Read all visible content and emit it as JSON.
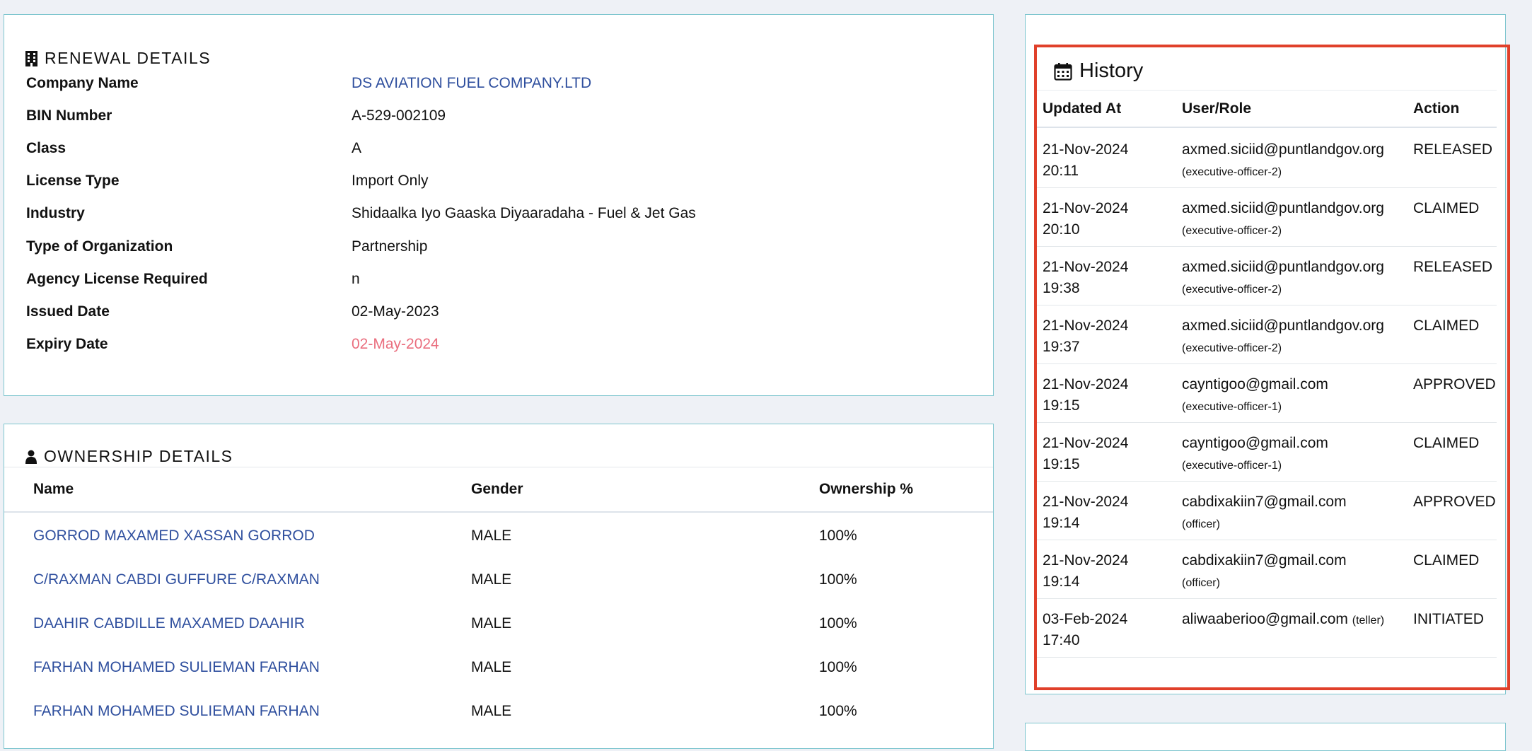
{
  "renewal": {
    "title": "RENEWAL DETAILS",
    "rows": [
      {
        "label": "Company Name",
        "value": "DS AVIATION FUEL COMPANY.LTD"
      },
      {
        "label": "BIN Number",
        "value": "A-529-002109"
      },
      {
        "label": "Class",
        "value": "A"
      },
      {
        "label": "License Type",
        "value": "Import Only"
      },
      {
        "label": "Industry",
        "value": "Shidaalka Iyo Gaaska Diyaaradaha - Fuel & Jet Gas"
      },
      {
        "label": "Type of Organization",
        "value": "Partnership"
      },
      {
        "label": "Agency License Required",
        "value": "n"
      },
      {
        "label": "Issued Date",
        "value": "02-May-2023"
      },
      {
        "label": "Expiry Date",
        "value": "02-May-2024"
      }
    ]
  },
  "ownership": {
    "title": "OWNERSHIP DETAILS",
    "columns": {
      "name": "Name",
      "gender": "Gender",
      "ownership": "Ownership %"
    },
    "rows": [
      {
        "name": "GORROD MAXAMED XASSAN GORROD",
        "gender": "MALE",
        "ownership": "100%"
      },
      {
        "name": "C/RAXMAN CABDI GUFFURE C/RAXMAN",
        "gender": "MALE",
        "ownership": "100%"
      },
      {
        "name": "DAAHIR CABDILLE MAXAMED DAAHIR",
        "gender": "MALE",
        "ownership": "100%"
      },
      {
        "name": "FARHAN MOHAMED SULIEMAN FARHAN",
        "gender": "MALE",
        "ownership": "100%"
      },
      {
        "name": "FARHAN MOHAMED SULIEMAN FARHAN",
        "gender": "MALE",
        "ownership": "100%"
      }
    ]
  },
  "history": {
    "title": "History",
    "columns": {
      "updated_at": "Updated At",
      "user_role": "User/Role",
      "action": "Action"
    },
    "rows": [
      {
        "date": "21-Nov-2024",
        "time": "20:11",
        "user": "axmed.siciid@puntlandgov.org",
        "role": "(executive-officer-2)",
        "action": "RELEASED"
      },
      {
        "date": "21-Nov-2024",
        "time": "20:10",
        "user": "axmed.siciid@puntlandgov.org",
        "role": "(executive-officer-2)",
        "action": "CLAIMED"
      },
      {
        "date": "21-Nov-2024",
        "time": "19:38",
        "user": "axmed.siciid@puntlandgov.org",
        "role": "(executive-officer-2)",
        "action": "RELEASED"
      },
      {
        "date": "21-Nov-2024",
        "time": "19:37",
        "user": "axmed.siciid@puntlandgov.org",
        "role": "(executive-officer-2)",
        "action": "CLAIMED"
      },
      {
        "date": "21-Nov-2024",
        "time": "19:15",
        "user": "cayntigoo@gmail.com",
        "role": "(executive-officer-1)",
        "action": "APPROVED"
      },
      {
        "date": "21-Nov-2024",
        "time": "19:15",
        "user": "cayntigoo@gmail.com",
        "role": "(executive-officer-1)",
        "action": "CLAIMED"
      },
      {
        "date": "21-Nov-2024",
        "time": "19:14",
        "user": "cabdixakiin7@gmail.com",
        "role": "(officer)",
        "action": "APPROVED"
      },
      {
        "date": "21-Nov-2024",
        "time": "19:14",
        "user": "cabdixakiin7@gmail.com",
        "role": "(officer)",
        "action": "CLAIMED"
      },
      {
        "date": "03-Feb-2024",
        "time": "17:40",
        "user": "aliwaaberioo@gmail.com",
        "role": "(teller)",
        "action": "INITIATED"
      }
    ]
  },
  "icons": {
    "renewal": "building-icon",
    "ownership": "user-icon",
    "history": "calendar-icon"
  },
  "colors": {
    "link": "#2f4f9e",
    "expired": "#ea6e7e",
    "card_border": "#7ec6cf",
    "highlight": "#e0402a"
  }
}
